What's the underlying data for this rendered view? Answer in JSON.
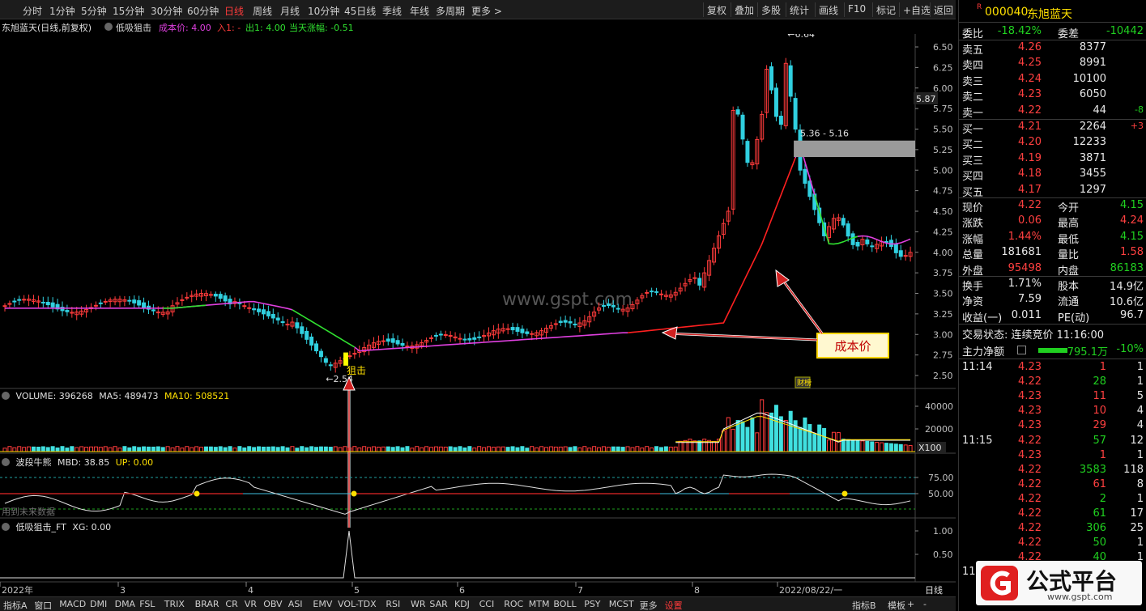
{
  "toolbar": {
    "timeframes": [
      "分时",
      "1分钟",
      "5分钟",
      "15分钟",
      "30分钟",
      "60分钟",
      "日线",
      "周线",
      "月线",
      "10分钟",
      "45日线",
      "季线",
      "年线",
      "多周期",
      "更多 >"
    ],
    "active_timeframe": "日线",
    "tools": [
      "复权",
      "叠加",
      "多股",
      "统计",
      "画线",
      "F10",
      "标记",
      "+自选",
      "返回"
    ]
  },
  "info": {
    "stock_title": "东旭蓝天(日线,前复权)",
    "indicator_name": "低吸狙击",
    "cost_label": "成本价: 4.00",
    "in_label": "入1: -",
    "out_label": "出1: 4.00",
    "change_label": "当天涨幅: -0.51"
  },
  "main_chart": {
    "y_ticks": [
      "6.50",
      "6.25",
      "6.00",
      "5.75",
      "5.50",
      "5.25",
      "5.00",
      "4.75",
      "4.50",
      "4.25",
      "4.00",
      "3.75",
      "3.50",
      "3.25",
      "3.00",
      "2.75",
      "2.50"
    ],
    "current_price_tag": "5.87",
    "high_label": "6.64",
    "low_label": "2.54",
    "range_label": "5.36 - 5.16",
    "signal_label": "狙击",
    "cost_callout": "成本价",
    "watermark": "www.gspt.com",
    "news_tag": "财"
  },
  "volume": {
    "title": "VOLUME: 396268",
    "ma5": "MA5: 489473",
    "ma10": "MA10: 508521",
    "y_ticks": [
      "40000",
      "20000"
    ],
    "unit": "X100"
  },
  "mbd": {
    "title": "波段牛熊",
    "mbd": "MBD: 38.85",
    "up": "UP: 0.00",
    "y_ticks": [
      "75.00",
      "50.00"
    ],
    "note": "用到未来数据"
  },
  "xg": {
    "title": "低吸狙击_FT",
    "xg": "XG: 0.00",
    "y_ticks": [
      "1.00",
      "0.50"
    ]
  },
  "x_axis": {
    "labels": [
      "2022年",
      "3",
      "4",
      "5",
      "6",
      "7",
      "8",
      "2022/08/22/一"
    ],
    "period": "日线"
  },
  "bottom_tabs": [
    "指标A",
    "窗口",
    "MACD",
    "DMI",
    "DMA",
    "FSL",
    "TRIX",
    "BRAR",
    "CR",
    "VR",
    "OBV",
    "ASI",
    "EMV",
    "VOL-TDX",
    "RSI",
    "WR",
    "SAR",
    "KDJ",
    "CCI",
    "ROC",
    "MTM",
    "BOLL",
    "PSY",
    "MCST",
    "更多",
    "设置"
  ],
  "bottom_right": [
    "指标B",
    "模板",
    "+",
    "-"
  ],
  "quote": {
    "code": "000040",
    "name": "东旭蓝天",
    "badge": "R",
    "weibi_label": "委比",
    "weibi": "-18.42%",
    "weicha_label": "委差",
    "weicha": "-10442",
    "asks": [
      {
        "label": "卖五",
        "price": "4.26",
        "vol": "8377",
        "chg": ""
      },
      {
        "label": "卖四",
        "price": "4.25",
        "vol": "8991",
        "chg": ""
      },
      {
        "label": "卖三",
        "price": "4.24",
        "vol": "10100",
        "chg": ""
      },
      {
        "label": "卖二",
        "price": "4.23",
        "vol": "6050",
        "chg": ""
      },
      {
        "label": "卖一",
        "price": "4.22",
        "vol": "44",
        "chg": "-8"
      }
    ],
    "bids": [
      {
        "label": "买一",
        "price": "4.21",
        "vol": "2264",
        "chg": "+3"
      },
      {
        "label": "买二",
        "price": "4.20",
        "vol": "12233",
        "chg": ""
      },
      {
        "label": "买三",
        "price": "4.19",
        "vol": "3871",
        "chg": ""
      },
      {
        "label": "买四",
        "price": "4.18",
        "vol": "3455",
        "chg": ""
      },
      {
        "label": "买五",
        "price": "4.17",
        "vol": "1297",
        "chg": ""
      }
    ],
    "stats": [
      {
        "l1": "现价",
        "v1": "4.22",
        "c1": "red",
        "l2": "今开",
        "v2": "4.15",
        "c2": "green"
      },
      {
        "l1": "涨跌",
        "v1": "0.06",
        "c1": "red",
        "l2": "最高",
        "v2": "4.24",
        "c2": "red"
      },
      {
        "l1": "涨幅",
        "v1": "1.44%",
        "c1": "red",
        "l2": "最低",
        "v2": "4.15",
        "c2": "green"
      },
      {
        "l1": "总量",
        "v1": "181681",
        "c1": "white",
        "l2": "量比",
        "v2": "1.58",
        "c2": "red"
      },
      {
        "l1": "外盘",
        "v1": "95498",
        "c1": "red",
        "l2": "内盘",
        "v2": "86183",
        "c2": "green"
      }
    ],
    "stats2": [
      {
        "l1": "换手",
        "v1": "1.71%",
        "l2": "股本",
        "v2": "14.9亿"
      },
      {
        "l1": "净资",
        "v1": "7.59",
        "l2": "流通",
        "v2": "10.6亿"
      },
      {
        "l1": "收益(一)",
        "v1": "0.011",
        "l2": "PE(动)",
        "v2": "96.7"
      }
    ],
    "trade_status": "交易状态: 连续竞价 11:16:00",
    "net_flow_label": "主力净额",
    "net_flow": "-795.1万",
    "net_flow_pct": "-10%",
    "ticks": [
      {
        "time": "11:14",
        "price": "4.23",
        "vol": "1",
        "cnt": "1",
        "vc": "red"
      },
      {
        "time": "",
        "price": "4.22",
        "vol": "28",
        "cnt": "1",
        "vc": "green"
      },
      {
        "time": "",
        "price": "4.23",
        "vol": "11",
        "cnt": "5",
        "vc": "red"
      },
      {
        "time": "",
        "price": "4.23",
        "vol": "10",
        "cnt": "4",
        "vc": "red"
      },
      {
        "time": "",
        "price": "4.23",
        "vol": "29",
        "cnt": "4",
        "vc": "red"
      },
      {
        "time": "11:15",
        "price": "4.22",
        "vol": "57",
        "cnt": "12",
        "vc": "green"
      },
      {
        "time": "",
        "price": "4.23",
        "vol": "1",
        "cnt": "1",
        "vc": "red"
      },
      {
        "time": "",
        "price": "4.22",
        "vol": "3583",
        "cnt": "118",
        "vc": "green"
      },
      {
        "time": "",
        "price": "4.22",
        "vol": "61",
        "cnt": "8",
        "vc": "red"
      },
      {
        "time": "",
        "price": "4.22",
        "vol": "2",
        "cnt": "1",
        "vc": "green"
      },
      {
        "time": "",
        "price": "4.22",
        "vol": "61",
        "cnt": "17",
        "vc": "green"
      },
      {
        "time": "",
        "price": "4.22",
        "vol": "306",
        "cnt": "25",
        "vc": "green"
      },
      {
        "time": "",
        "price": "4.22",
        "vol": "50",
        "cnt": "1",
        "vc": "green"
      },
      {
        "time": "",
        "price": "4.22",
        "vol": "40",
        "cnt": "1",
        "vc": "green"
      },
      {
        "time": "11",
        "price": "",
        "vol": "",
        "cnt": "",
        "vc": "green"
      }
    ]
  },
  "logo": {
    "text": "公式平台",
    "url_text": "www.gspt.com"
  },
  "colors": {
    "up": "#ff3b3b",
    "down": "#30d0e0",
    "cost_line": "#e040e0",
    "green_line": "#30e030",
    "callout_border": "#ffd700"
  }
}
